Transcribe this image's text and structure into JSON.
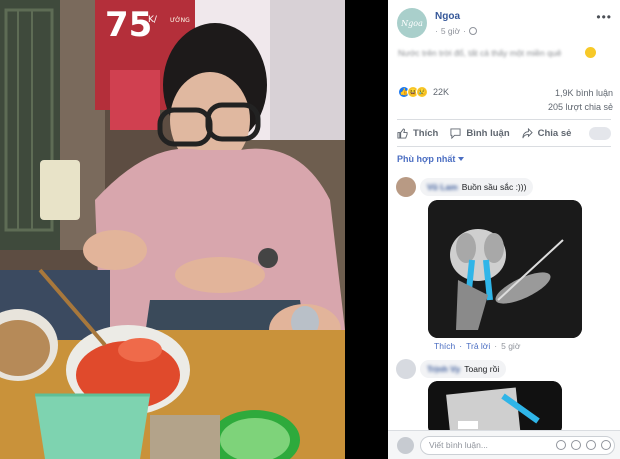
{
  "post": {
    "author": "Ngoa",
    "avatar_text": "Ngoa",
    "time": "5 giờ",
    "caption": "Nước trên trời đổ, tất cả thấy một miền quê",
    "more_icon": "more-horizontal-icon",
    "privacy_icon": "globe-icon"
  },
  "reactions": {
    "count": "22K",
    "types": [
      "like",
      "haha",
      "sad"
    ],
    "comments": "1,9K bình luận",
    "shares": "205 lượt chia sẻ"
  },
  "actions": {
    "like": "Thích",
    "comment": "Bình luận",
    "share": "Chia sẻ"
  },
  "sort_label": "Phù hợp nhất",
  "comments": [
    {
      "name": "Vũ Lam",
      "text": "Buồn sầu sắc :)))",
      "media": "crying-dog-violin-meme",
      "reply_like": "Thích",
      "reply": "Trả lời",
      "time": "5 giờ"
    },
    {
      "name": "Trịnh Vy",
      "text": "Toang rồi",
      "media": "crying-meme"
    }
  ],
  "photo": {
    "sign_text": "75",
    "sign_subtext": "ƯỚNG",
    "sign_suffix": "K/"
  },
  "composer": {
    "placeholder": "Viết bình luận..."
  },
  "colors": {
    "link_blue": "#365899",
    "like_blue": "#1877f2",
    "panel_bg": "#ffffff"
  }
}
